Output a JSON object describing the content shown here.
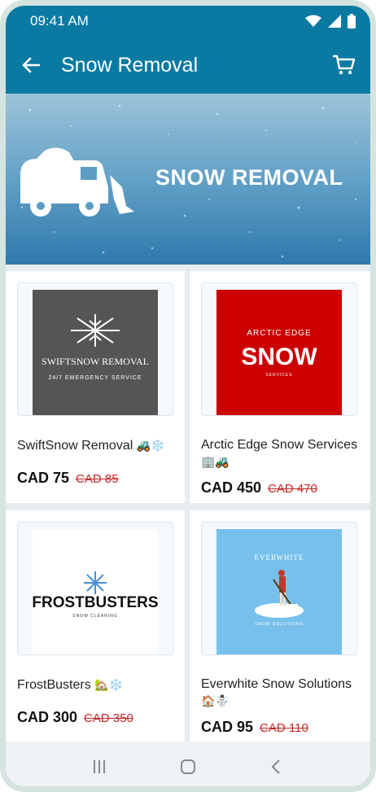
{
  "status": {
    "time": "09:41 AM"
  },
  "appbar": {
    "title": "Snow Removal"
  },
  "banner": {
    "title": "SNOW REMOVAL"
  },
  "products": [
    {
      "name": "SwiftSnow Removal",
      "emoji": "🚜❄️",
      "price": "CAD 75",
      "old_price": "CAD 85",
      "logo": {
        "line1": "SWIFTSNOW REMOVAL",
        "line2": "24/7 EMERGENCY SERVICE"
      }
    },
    {
      "name": "Arctic Edge Snow Services",
      "emoji": "🏢🚜",
      "price": "CAD 450",
      "old_price": "CAD 470",
      "logo": {
        "line1": "ARCTIC EDGE",
        "line2": "SNOW",
        "line3": "SERVICES"
      }
    },
    {
      "name": "FrostBusters",
      "emoji": "🏡❄️",
      "price": "CAD 300",
      "old_price": "CAD 350",
      "logo": {
        "line1": "FROSTBUSTERS",
        "line2": "SNOW CLEARING"
      }
    },
    {
      "name": "Everwhite Snow Solutions",
      "emoji": "🏠☃️",
      "price": "CAD 95",
      "old_price": "CAD 110",
      "logo": {
        "line1": "EVERWHITE",
        "line2": "SNOW SOLUTIONS"
      }
    }
  ],
  "colors": {
    "primary": "#0a7aa3",
    "sale": "#c62828",
    "arctic_red": "#cc0000",
    "everwhite_blue": "#77c0ec",
    "swift_grey": "#555555"
  }
}
